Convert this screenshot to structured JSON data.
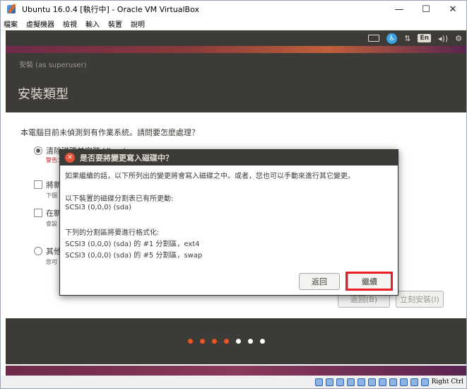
{
  "window": {
    "title": "Ubuntu 16.0.4 [執行中] - Oracle VM VirtualBox",
    "controls": [
      "—",
      "☐",
      "✕"
    ]
  },
  "menu": [
    "檔案",
    "虛擬機器",
    "檢視",
    "輸入",
    "裝置",
    "說明"
  ],
  "panel": {
    "lang": "En",
    "volume": "◂))",
    "transfer": "⇅",
    "settings": "⚙"
  },
  "installer": {
    "subtitle": "安裝 (as superuser)",
    "title": "安裝類型",
    "question": "本電腦目前未偵測到有作業系統。請問要怎麼處理？",
    "options": [
      {
        "label": "清除磁碟並安裝 Ubuntu",
        "desc": "警告：",
        "selected": true
      },
      {
        "label": "將新",
        "desc": "下個",
        "selected": false
      },
      {
        "label": "在新",
        "desc": "會設",
        "selected": false
      },
      {
        "label": "其他",
        "desc": "您可",
        "selected": false
      }
    ],
    "back_button": "返回(B)",
    "install_button": "立刻安裝(I)",
    "progress_dots": [
      "#e95420",
      "#e95420",
      "#e95420",
      "#e95420",
      "#ffffff",
      "#ffffff",
      "#ffffff"
    ]
  },
  "dialog": {
    "title": "是否要將變更寫入磁碟中？",
    "intro": "如果繼續的話，以下所列出的變更將會寫入磁碟之中。或者，您也可以手動來進行其它變更。",
    "table_header": "以下裝置的磁碟分割表已有所更動:",
    "table_device": "SCSI3 (0,0,0) (sda)",
    "format_header": "下列的分割區將要進行格式化:",
    "format_lines": [
      "SCSI3 (0,0,0) (sda) 的 #1 分割區，ext4",
      "SCSI3 (0,0,0) (sda) 的 #5 分割區，swap"
    ],
    "back_button": "返回",
    "continue_button": "繼續"
  },
  "statusbar": {
    "host_key": "Right Ctrl"
  }
}
